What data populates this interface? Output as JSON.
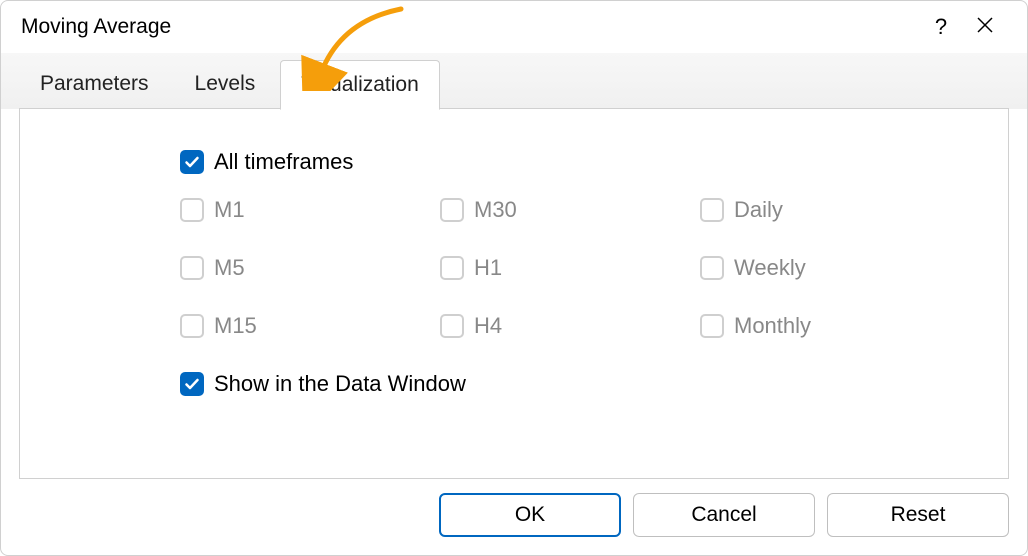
{
  "dialog": {
    "title": "Moving Average"
  },
  "tabs": {
    "parameters": "Parameters",
    "levels": "Levels",
    "visualization": "Visualization"
  },
  "options": {
    "all_timeframes": "All timeframes",
    "show_data_window": "Show in the Data Window"
  },
  "timeframes": {
    "m1": "M1",
    "m5": "M5",
    "m15": "M15",
    "m30": "M30",
    "h1": "H1",
    "h4": "H4",
    "daily": "Daily",
    "weekly": "Weekly",
    "monthly": "Monthly"
  },
  "buttons": {
    "ok": "OK",
    "cancel": "Cancel",
    "reset": "Reset"
  }
}
